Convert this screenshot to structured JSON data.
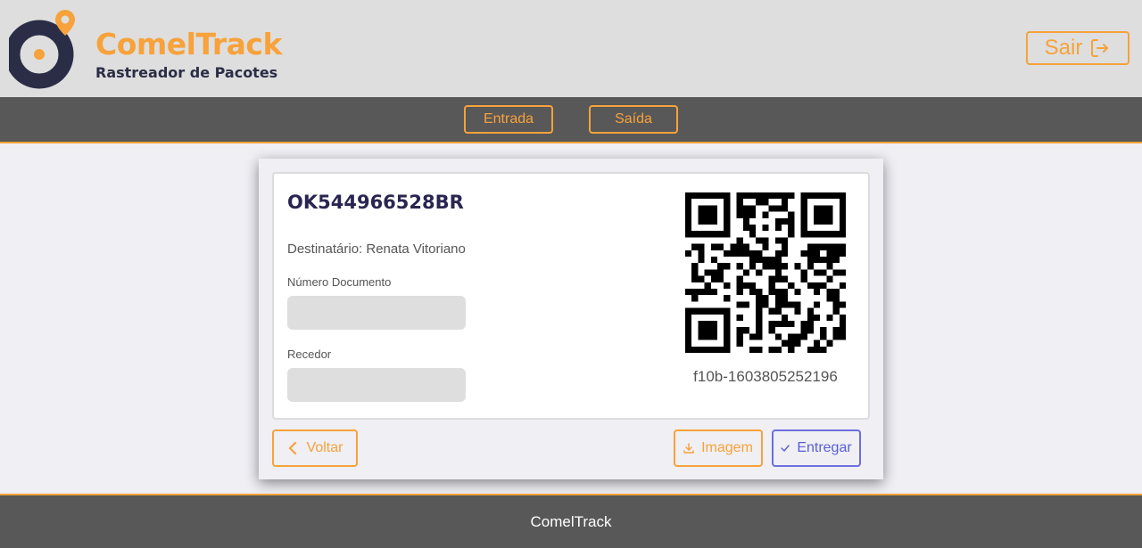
{
  "brand": {
    "name": "ComelTrack",
    "subtitle": "Rastreador de Pacotes"
  },
  "header": {
    "logout_label": "Sair",
    "logout_icon": "logout-icon"
  },
  "nav": {
    "items": [
      {
        "label": "Entrada"
      },
      {
        "label": "Saída"
      }
    ]
  },
  "package": {
    "tracking_code": "OK544966528BR",
    "recipient": "Destinatário: Renata Vitoriano",
    "document_label": "Número Documento",
    "document_value": "",
    "receiver_label": "Recedor",
    "receiver_value": "",
    "qr_code_text": "f10b-1603805252196"
  },
  "actions": {
    "back_label": "Voltar",
    "back_icon": "chevron-left-icon",
    "image_label": "Imagem",
    "image_icon": "download-icon",
    "deliver_label": "Entregar",
    "deliver_icon": "check-icon"
  },
  "footer": {
    "text": "ComelTrack"
  },
  "colors": {
    "accent": "#f7a23a",
    "dark": "#585858",
    "navy": "#2a2d45",
    "primary": "#5b5dd6"
  }
}
